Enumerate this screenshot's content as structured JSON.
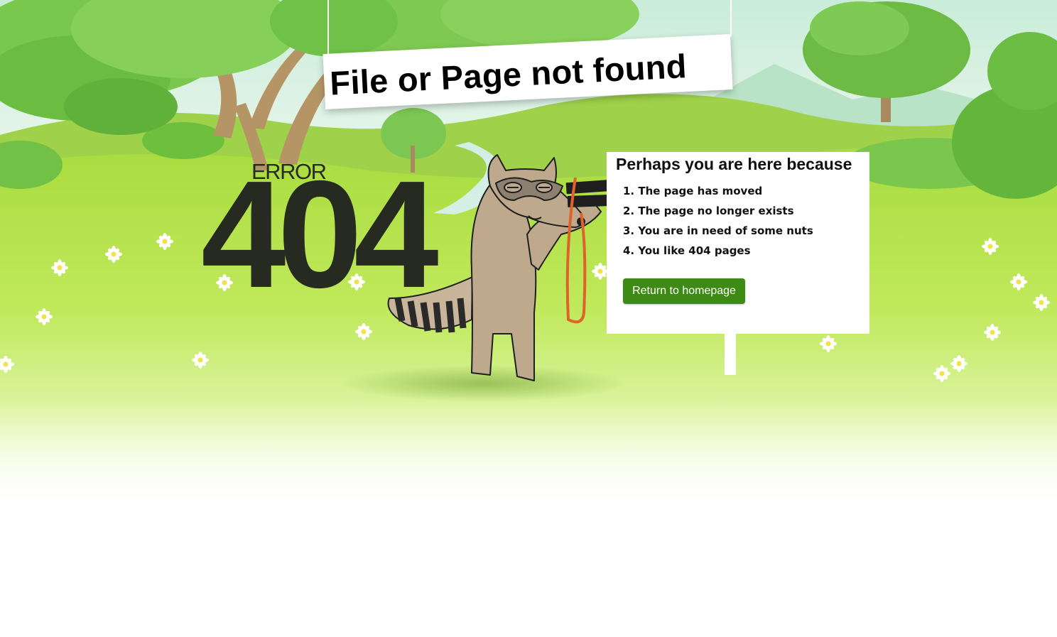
{
  "page": {
    "title": "File or Page not found",
    "error_label": "ERROR",
    "error_code": "404"
  },
  "info": {
    "heading": "Perhaps you are here because",
    "reasons": [
      "1. The page has moved",
      "2. The page no longer exists",
      "3. You are in need of some nuts",
      "4. You like 404 pages"
    ],
    "button_label": "Return to homepage"
  },
  "colors": {
    "accent_green": "#3d8a14",
    "code_text": "#262a21",
    "meadow": "#b4e24c",
    "sky": "#dff3f0"
  },
  "icons": [
    "raccoon-with-binoculars",
    "tree",
    "daisy-flower",
    "hanging-sign",
    "signpost"
  ]
}
